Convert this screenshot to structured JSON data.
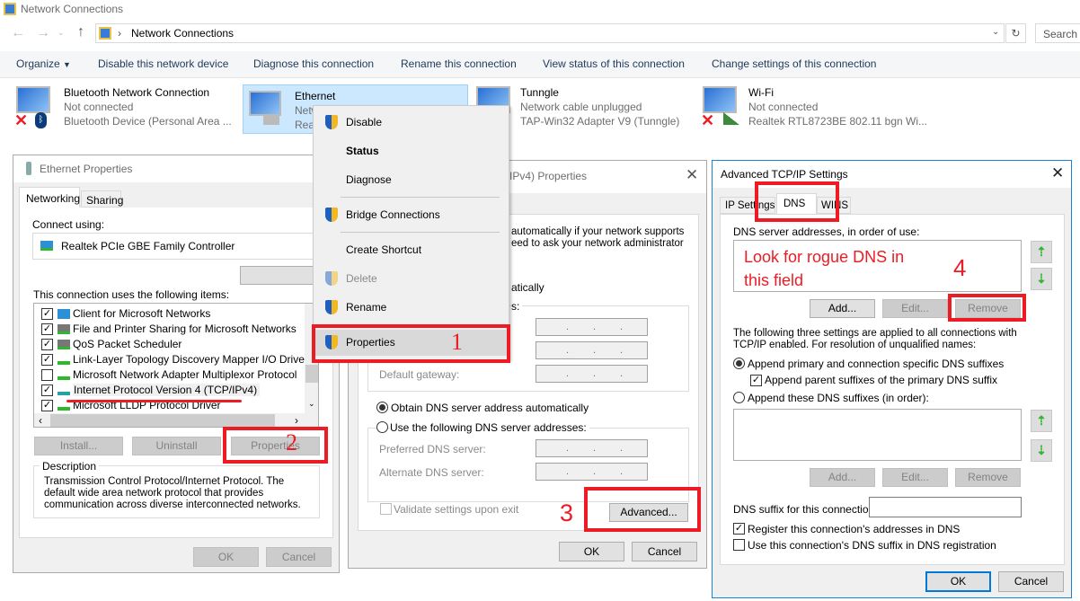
{
  "window": {
    "title": "Network Connections"
  },
  "address": {
    "path": "Network Connections",
    "search_placeholder": "Search N"
  },
  "toolbar": {
    "organize": "Organize",
    "items": [
      "Disable this network device",
      "Diagnose this connection",
      "Rename this connection",
      "View status of this connection",
      "Change settings of this connection"
    ]
  },
  "connections": [
    {
      "name": "Bluetooth Network Connection",
      "status": "Not connected",
      "device": "Bluetooth Device (Personal Area ..."
    },
    {
      "name": "Ethernet",
      "status": "Netw",
      "device": "Real"
    },
    {
      "name": "Tunngle",
      "status": "Network cable unplugged",
      "device": "TAP-Win32 Adapter V9 (Tunngle)"
    },
    {
      "name": "Wi-Fi",
      "status": "Not connected",
      "device": "Realtek RTL8723BE 802.11 bgn Wi..."
    }
  ],
  "context_menu": {
    "items": [
      "Disable",
      "Status",
      "Diagnose",
      "Bridge Connections",
      "Create Shortcut",
      "Delete",
      "Rename",
      "Properties"
    ]
  },
  "ethernet_props": {
    "title": "Ethernet Properties",
    "tabs": [
      "Networking",
      "Sharing"
    ],
    "connect_using_label": "Connect using:",
    "adapter": "Realtek PCIe GBE Family Controller",
    "items_label": "This connection uses the following items:",
    "items": [
      {
        "label": "Client for Microsoft Networks",
        "checked": true
      },
      {
        "label": "File and Printer Sharing for Microsoft Networks",
        "checked": true
      },
      {
        "label": "QoS Packet Scheduler",
        "checked": true
      },
      {
        "label": "Link-Layer Topology Discovery Mapper I/O Driver",
        "checked": true
      },
      {
        "label": "Microsoft Network Adapter Multiplexor Protocol",
        "checked": false
      },
      {
        "label": "Internet Protocol Version 4 (TCP/IPv4)",
        "checked": true
      },
      {
        "label": "Microsoft LLDP Protocol Driver",
        "checked": true
      }
    ],
    "buttons": {
      "install": "Install...",
      "uninstall": "Uninstall",
      "properties": "Properties"
    },
    "description_label": "Description",
    "description": "Transmission Control Protocol/Internet Protocol. The default wide area network protocol that provides communication across diverse interconnected networks.",
    "ok": "OK",
    "cancel": "Cancel"
  },
  "ipv4_props": {
    "title": "IPv4) Properties",
    "intro_1": "automatically if your network supports",
    "intro_2": "eed to ask your network administrator",
    "auto_ip_fragment": "atically",
    "group_fragment": "s:",
    "default_gateway": "Default gateway:",
    "dns_auto": "Obtain DNS server address automatically",
    "dns_manual": "Use the following DNS server addresses:",
    "preferred_dns": "Preferred DNS server:",
    "alternate_dns": "Alternate DNS server:",
    "validate": "Validate settings upon exit",
    "advanced": "Advanced...",
    "ok": "OK",
    "cancel": "Cancel"
  },
  "advanced_tcpip": {
    "title": "Advanced TCP/IP Settings",
    "tabs": [
      "IP Settings",
      "DNS",
      "WINS"
    ],
    "dns_servers_label": "DNS server addresses, in order of use:",
    "add": "Add...",
    "edit": "Edit...",
    "remove": "Remove",
    "info": "The following three settings are applied to all connections with TCP/IP enabled. For resolution of unqualified names:",
    "append_primary": "Append primary and connection specific DNS suffixes",
    "append_parent": "Append parent suffixes of the primary DNS suffix",
    "append_these": "Append these DNS suffixes (in order):",
    "suffix_label": "DNS suffix for this connection:",
    "suffix_value": "",
    "register": "Register this connection's addresses in DNS",
    "use_suffix": "Use this connection's DNS suffix in DNS registration",
    "ok": "OK",
    "cancel": "Cancel"
  },
  "annotations": {
    "step1": "1",
    "step2": "2",
    "step3": "3",
    "step4": "4",
    "note_line1": "Look for rogue DNS in",
    "note_line2": "this field"
  },
  "colors": {
    "annotation_red": "#ed1c24",
    "selection": "#cce8ff",
    "dialog_accent": "#1883d7"
  }
}
